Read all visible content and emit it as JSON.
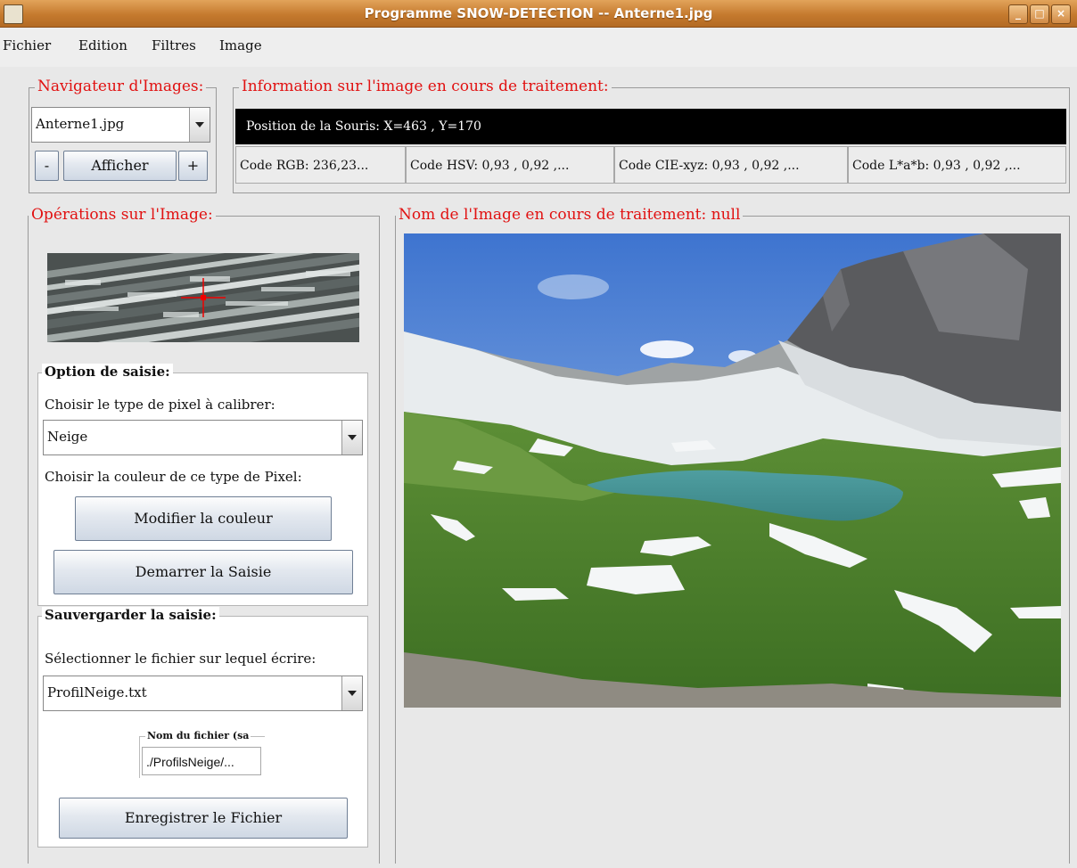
{
  "window": {
    "title": "Programme SNOW-DETECTION --  Anterne1.jpg",
    "controls": [
      "_",
      "□",
      "×"
    ]
  },
  "menu": [
    "Fichier",
    "Edition",
    "Filtres",
    "Image"
  ],
  "navigator": {
    "title": "Navigateur d'Images:",
    "selected_image": "Anterne1.jpg",
    "prev_label": "-",
    "show_label": "Afficher",
    "next_label": "+"
  },
  "info": {
    "title": "Information sur l'image en cours de traitement:",
    "mouse_position": "Position de la Souris: X=463  ,  Y=170",
    "rgb": "Code RGB: 236,23...",
    "hsv": "Code HSV: 0,93 , 0,92 ,...",
    "xyz": "Code CIE-xyz: 0,93 , 0,92 ,...",
    "lab": "Code L*a*b: 0,93 , 0,92 ,..."
  },
  "operations": {
    "title": "Opérations sur l'Image:",
    "capture_options": {
      "title": "Option de saisie:",
      "pixel_type_label": "Choisir le type de pixel à calibrer:",
      "pixel_type": "Neige",
      "color_label": "Choisir la couleur de ce type de Pixel:",
      "modify_color_button": "Modifier la couleur",
      "start_capture_button": "Demarrer la Saisie"
    },
    "save": {
      "title": "Sauvergarder la saisie:",
      "file_label": "Sélectionner le fichier sur lequel écrire:",
      "file": "ProfilNeige.txt",
      "filename_group_title": "Nom du fichier (sa",
      "filename_value": "./ProfilsNeige/...",
      "save_button": "Enregistrer le Fichier"
    }
  },
  "image_panel": {
    "title": "Nom de l'Image en cours de traitement:   null",
    "image_subject": "mountain lake landscape with snow patches"
  },
  "colors": {
    "titlebar": "#c57a2e",
    "group_title": "#e11111",
    "info_bar": "#000000"
  }
}
